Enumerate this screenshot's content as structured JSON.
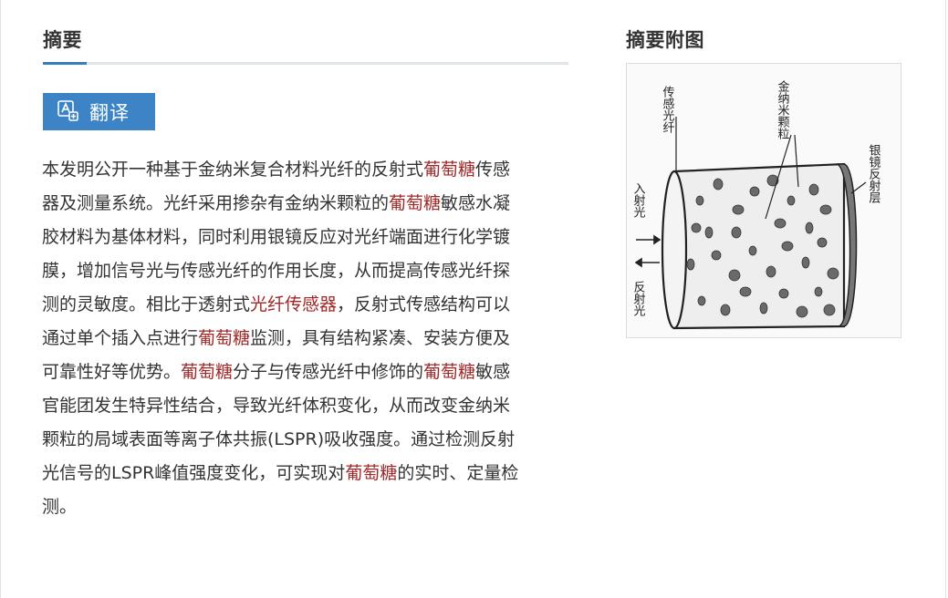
{
  "abstract": {
    "heading": "摘要",
    "translate_label": "翻译",
    "lines": [
      [
        {
          "t": "本发明公开一种基于金纳米复合材料光纤的反射式"
        },
        {
          "t": "葡萄糖",
          "kw": true
        },
        {
          "t": "传感"
        }
      ],
      [
        {
          "t": "器及测量系统。光纤采用掺杂有金纳米颗粒的"
        },
        {
          "t": "葡萄糖",
          "kw": true
        },
        {
          "t": "敏感水凝"
        }
      ],
      [
        {
          "t": "胶材料为基体材料，同时利用银镜反应对光纤端面进行化学镀"
        }
      ],
      [
        {
          "t": "膜，增加信号光与传感光纤的作用长度，从而提高传感光纤探"
        }
      ],
      [
        {
          "t": "测的灵敏度。相比于透射式"
        },
        {
          "t": "光纤传感器",
          "kw": true
        },
        {
          "t": "，反射式传感结构可以"
        }
      ],
      [
        {
          "t": "通过单个插入点进行"
        },
        {
          "t": "葡萄糖",
          "kw": true
        },
        {
          "t": "监测，具有结构紧凑、安装方便及"
        }
      ],
      [
        {
          "t": "可靠性好等优势。"
        },
        {
          "t": "葡萄糖",
          "kw": true
        },
        {
          "t": "分子与传感光纤中修饰的"
        },
        {
          "t": "葡萄糖",
          "kw": true
        },
        {
          "t": "敏感"
        }
      ],
      [
        {
          "t": "官能团发生特异性结合，导致光纤体积变化，从而改变金纳米"
        }
      ],
      [
        {
          "t": "颗粒的局域表面等离子体共振(LSPR)吸收强度。通过检测反射"
        }
      ],
      [
        {
          "t": "光信号的LSPR峰值强度变化，可实现对"
        },
        {
          "t": "葡萄糖",
          "kw": true
        },
        {
          "t": "的实时、定量检"
        }
      ],
      [
        {
          "t": "测。"
        }
      ]
    ]
  },
  "figure": {
    "heading": "摘要附图",
    "labels": {
      "sensing_fiber": "传感光纤",
      "gold_particles": "金纳米颗粒",
      "silver_layer": "银镜反射层",
      "incident": "入射光",
      "reflected": "反射光"
    }
  },
  "colors": {
    "accent": "#3d84c6",
    "keyword": "#a02828",
    "text": "#333333"
  }
}
